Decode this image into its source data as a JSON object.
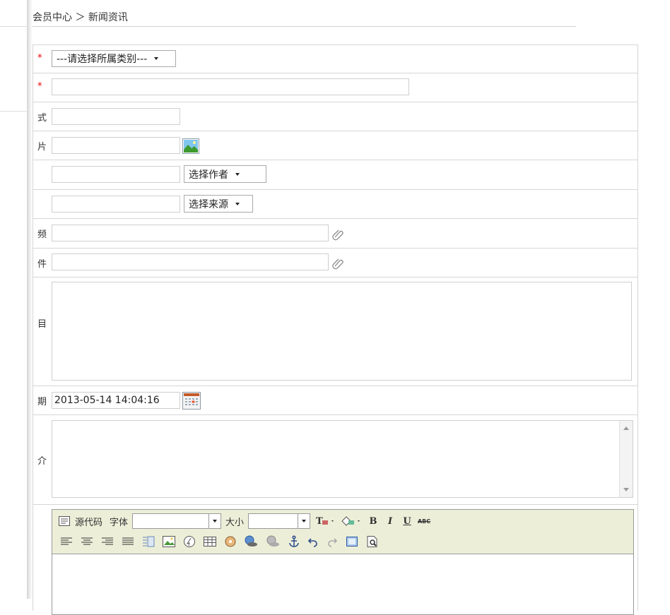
{
  "breadcrumb": {
    "text": "会员中心 ＞ 新闻资讯",
    "visible": "会员中心 ＞ 新闻资讯"
  },
  "labels": {
    "category": "*",
    "title": "*",
    "style": "式",
    "image": "片",
    "content": "目",
    "date": "期",
    "summary": "介",
    "links": "频",
    "attach": "件"
  },
  "category_select": {
    "selected": "---请选择所属类别---"
  },
  "author_select": {
    "selected": "选择作者"
  },
  "source_select": {
    "selected": "选择来源"
  },
  "date_input": {
    "value": "2013-05-14 14:04:16"
  },
  "editor": {
    "source_label": "源代码",
    "font_label": "字体",
    "size_label": "大小",
    "bold": "B",
    "italic": "I",
    "underline": "U",
    "strike": "ABC"
  },
  "colors": {
    "required": "#e00000",
    "toolbar_bg": "#eceed8",
    "border": "#d6d6d6"
  }
}
